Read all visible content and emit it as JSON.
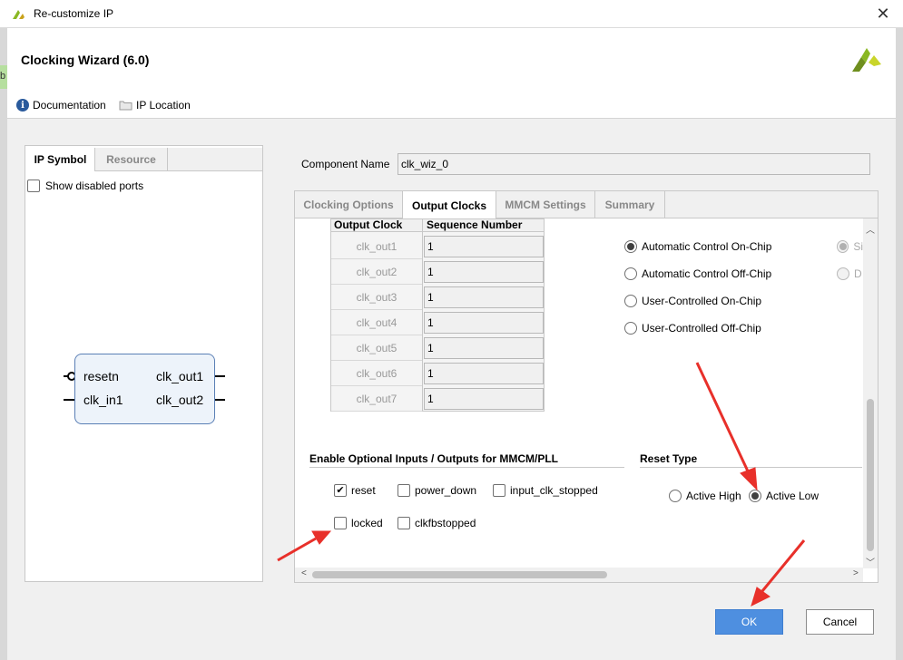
{
  "window": {
    "title": "Re-customize IP",
    "close_glyph": "✕"
  },
  "header": {
    "title": "Clocking Wizard (6.0)",
    "documentation_label": "Documentation",
    "ip_location_label": "IP Location",
    "edge_letter": "b"
  },
  "left_panel": {
    "tabs": [
      "IP Symbol",
      "Resource"
    ],
    "show_disabled_label": "Show disabled ports",
    "symbol": {
      "left_ports": [
        "resetn",
        "clk_in1"
      ],
      "right_ports": [
        "clk_out1",
        "clk_out2"
      ]
    }
  },
  "component": {
    "label": "Component Name",
    "value": "clk_wiz_0"
  },
  "right_panel": {
    "tabs": [
      "Clocking Options",
      "Output Clocks",
      "MMCM Settings",
      "Summary"
    ],
    "active_tab": "Output Clocks",
    "table": {
      "headers": [
        "Output Clock",
        "Sequence Number"
      ],
      "rows": [
        {
          "clock": "clk_out1",
          "seq": "1"
        },
        {
          "clock": "clk_out2",
          "seq": "1"
        },
        {
          "clock": "clk_out3",
          "seq": "1"
        },
        {
          "clock": "clk_out4",
          "seq": "1"
        },
        {
          "clock": "clk_out5",
          "seq": "1"
        },
        {
          "clock": "clk_out6",
          "seq": "1"
        },
        {
          "clock": "clk_out7",
          "seq": "1"
        }
      ]
    },
    "buffer_options": [
      "Automatic Control On-Chip",
      "Automatic Control Off-Chip",
      "User-Controlled On-Chip",
      "User-Controlled Off-Chip"
    ],
    "buffer_selected": "Automatic Control On-Chip",
    "clipped_options": [
      "Si",
      "D"
    ],
    "optional_io": {
      "title": "Enable Optional Inputs / Outputs for MMCM/PLL",
      "checkboxes": [
        {
          "label": "reset",
          "checked": true
        },
        {
          "label": "power_down",
          "checked": false
        },
        {
          "label": "input_clk_stopped",
          "checked": false
        },
        {
          "label": "locked",
          "checked": false
        },
        {
          "label": "clkfbstopped",
          "checked": false
        }
      ]
    },
    "reset_type": {
      "title": "Reset Type",
      "options": [
        "Active High",
        "Active Low"
      ],
      "selected": "Active Low"
    }
  },
  "buttons": {
    "ok": "OK",
    "cancel": "Cancel"
  },
  "colors": {
    "ok_button": "#4e8fe0",
    "annotation_arrow": "#e8302a",
    "logo_green": "#8ab823",
    "symbol_fill": "#edf3fa"
  },
  "icons": [
    "xilinx-logo-icon",
    "info-icon",
    "folder-icon",
    "close-icon",
    "scroll-up-icon",
    "scroll-down-icon",
    "scroll-left-icon",
    "scroll-right-icon"
  ]
}
